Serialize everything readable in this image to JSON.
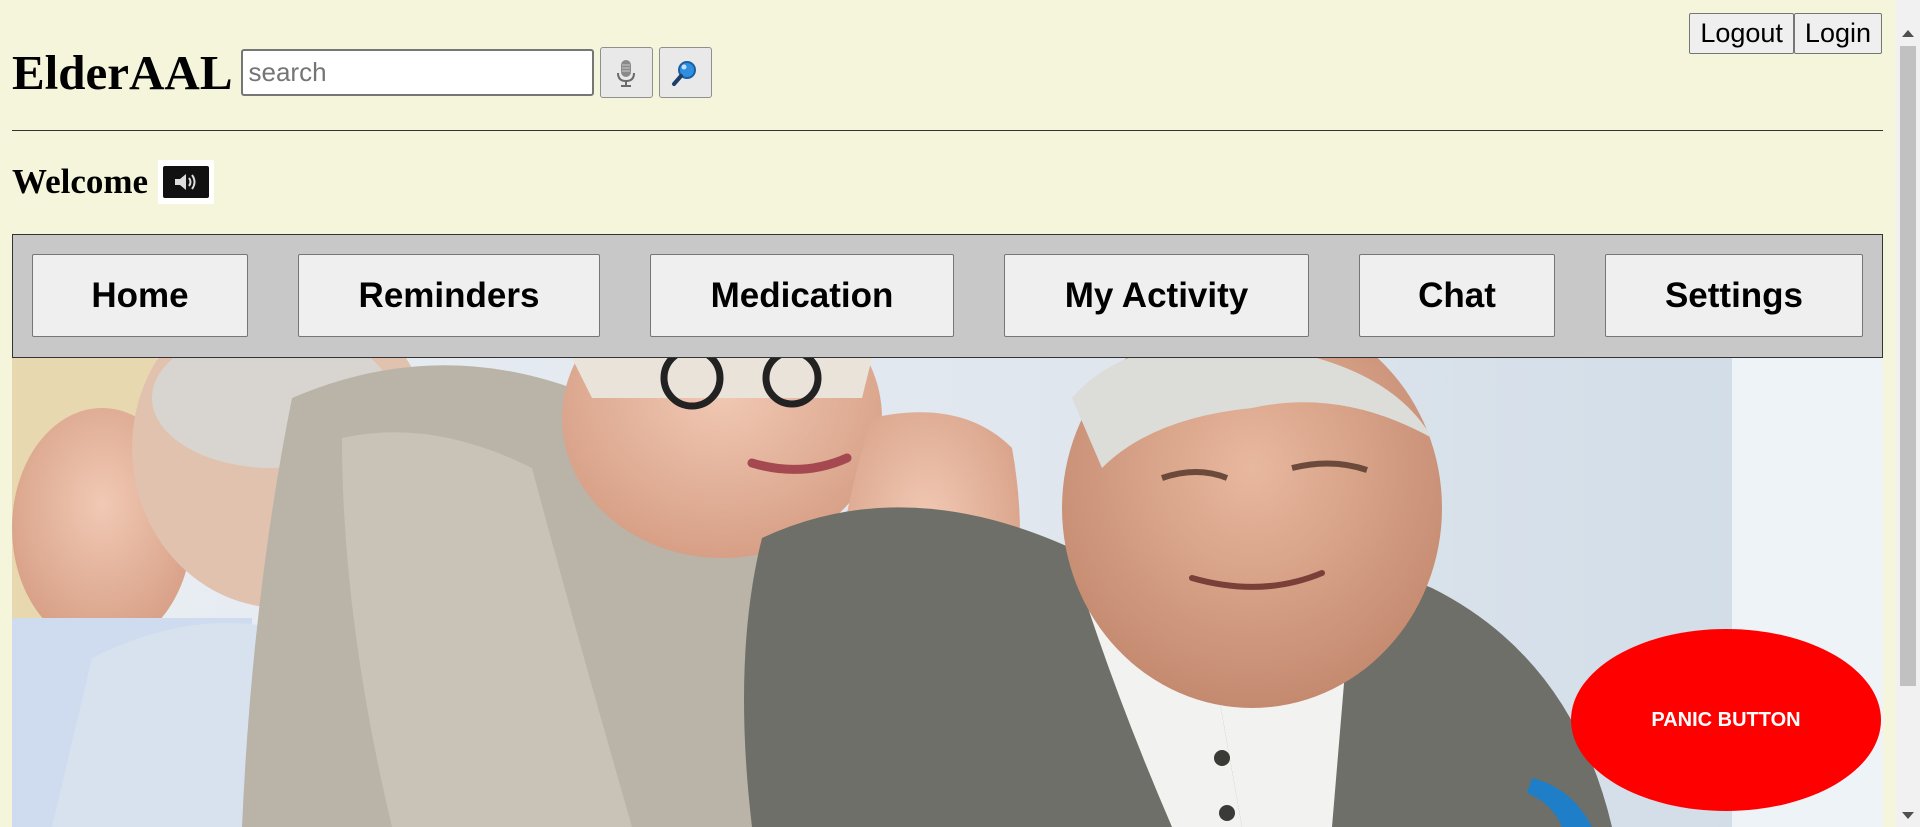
{
  "header": {
    "brand": "ElderAAL",
    "search": {
      "placeholder": "search"
    },
    "mic_button_icon": "microphone-icon",
    "search_button_icon": "magnifier-icon",
    "auth": {
      "logout_label": "Logout",
      "login_label": "Login"
    }
  },
  "welcome": {
    "text": "Welcome",
    "speaker_icon": "speaker-icon"
  },
  "nav": {
    "items": [
      {
        "label": "Home"
      },
      {
        "label": "Reminders"
      },
      {
        "label": "Medication"
      },
      {
        "label": "My Activity"
      },
      {
        "label": "Chat"
      },
      {
        "label": "Settings"
      }
    ]
  },
  "hero": {
    "image": "seniors-smiling-photo"
  },
  "panic": {
    "label": "PANIC BUTTON",
    "color": "#ff0000"
  },
  "colors": {
    "page_background": "#f5f5dc",
    "nav_background": "#c8c8c8"
  }
}
